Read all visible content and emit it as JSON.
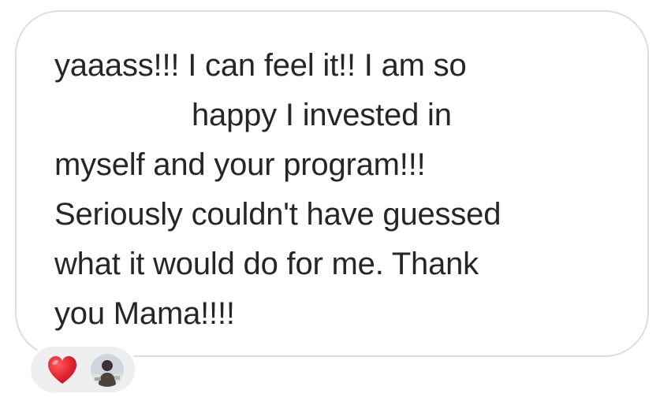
{
  "message": {
    "lines": [
      "yaaass!!! I can feel it!! I am so",
      "happy I invested in",
      "myself and your program!!!",
      "Seriously couldn't have guessed",
      "what it would do for me. Thank",
      "you Mama!!!!"
    ]
  },
  "reactions": {
    "emoji_icon": "red-heart-icon",
    "reactor_avatar": "user-avatar"
  },
  "colors": {
    "text": "#262626",
    "bubble_border": "#dedede",
    "reaction_bg": "#efefef",
    "heart": "#e0242e"
  }
}
